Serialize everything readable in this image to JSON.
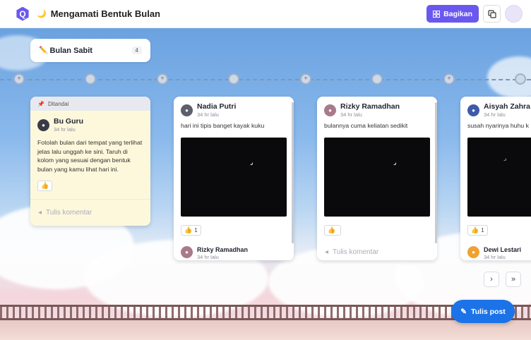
{
  "app": {
    "title": "Mengamati Bentuk Bulan",
    "title_icon": "crescent-moon-emoji",
    "brand_color": "#6a58ee"
  },
  "header": {
    "share_label": "Bagikan",
    "share_icon": "grid-icon",
    "copy_icon": "copy-icon"
  },
  "section": {
    "title": "Bulan Sabit",
    "icon": "pencil-emoji",
    "count": "4"
  },
  "pinned_post": {
    "pin_label": "Ditandai",
    "author": "Bu Guru",
    "time": "34 hr lalu",
    "text": "Fotolah bulan dari tempat yang terlihat jelas lalu unggah ke sini. Taruh di kolom yang sesuai dengan bentuk bulan yang kamu lihat hari ini.",
    "comment_placeholder": "Tulis komentar"
  },
  "posts": [
    {
      "author": "Nadia Putri",
      "time": "34 hr lalu",
      "text": "hari ini tipis banget kayak kuku",
      "likes": "1",
      "reply_author": "Rizky Ramadhan",
      "reply_time": "34 hr lalu"
    },
    {
      "author": "Rizky Ramadhan",
      "time": "34 hr lalu",
      "text": "bulannya cuma keliatan sedikit",
      "likes": "",
      "comment_placeholder": "Tulis komentar"
    },
    {
      "author": "Aisyah Zahra",
      "time": "34 hr lalu",
      "text": "susah nyarinya huhu k",
      "likes": "1",
      "reply_author": "Dewi Lestari",
      "reply_time": "34 hr lalu"
    }
  ],
  "nav": {
    "next_icon": "chevron-right-icon",
    "last_icon": "double-chevron-right-icon"
  },
  "fab": {
    "label": "Tulis post",
    "icon": "pencil-icon",
    "color": "#1c73e8"
  }
}
